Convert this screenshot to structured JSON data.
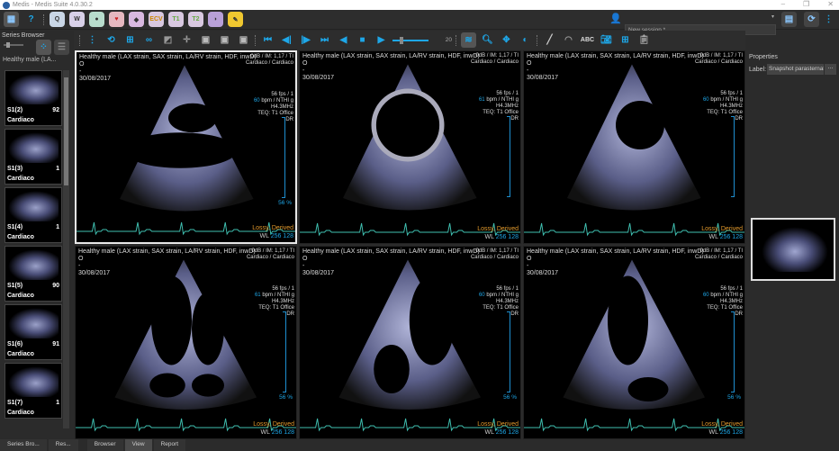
{
  "window": {
    "app": "Medis",
    "title": "Medis Suite 4.0.30.2"
  },
  "toolbar": {
    "help": "?",
    "apps": [
      "QMass",
      "QFlow",
      "3DView",
      "QStrain",
      "QTavi",
      "ECV",
      "T1",
      "T2",
      "QAngio",
      "Report"
    ],
    "session": "New session *",
    "frame_value": "20"
  },
  "left_panel": {
    "title": "Series Browser",
    "series_name": "Healthy male (LA...",
    "thumbnails": [
      {
        "label": "S1(2)",
        "count": "92",
        "sub": "Cardiaco"
      },
      {
        "label": "S1(3)",
        "count": "1",
        "sub": "Cardiaco"
      },
      {
        "label": "S1(4)",
        "count": "1",
        "sub": "Cardiaco"
      },
      {
        "label": "S1(5)",
        "count": "90",
        "sub": "Cardiaco"
      },
      {
        "label": "S1(6)",
        "count": "91",
        "sub": "Cardiaco"
      },
      {
        "label": "S1(7)",
        "count": "1",
        "sub": "Cardiaco"
      }
    ]
  },
  "viewports": [
    {
      "patient": "Healthy male (LAX strain, SAX strain, LA/RV strain, HDF, inwD)",
      "line2": "O",
      "line3": "-",
      "date": "30/08/2017",
      "tr1": "0dB / IM: 1,17 / TI",
      "tr2": "Cardiaco / Cardiaco",
      "fps": "56 fps / 1",
      "bpm": "60",
      "bpm_suffix": " bpm / NTHI g",
      "probe": "H4.3MHz",
      "teq": "TEQ: T1 Office",
      "dr": "DR",
      "pct": "56 %",
      "lossy": "Lossy, Derived",
      "wl_label": "WL ",
      "wl": "256 128"
    },
    {
      "patient": "Healthy male (LAX strain, SAX strain, LA/RV strain, HDF, inwD)",
      "line2": "O",
      "line3": "-",
      "date": "30/08/2017",
      "tr1": "0dB / IM: 1,17 / TI",
      "tr2": "Cardiaco / Cardiaco",
      "fps": "56 fps / 1",
      "bpm": "61",
      "bpm_suffix": " bpm / NTHI g",
      "probe": "H4.3MHz",
      "teq": "TEQ: T1 Office",
      "dr": "DR",
      "pct": "",
      "lossy": "Lossy, Derived",
      "wl_label": "WL ",
      "wl": "256 128"
    },
    {
      "patient": "Healthy male (LAX strain, SAX strain, LA/RV strain, HDF, inwD)",
      "line2": "O",
      "line3": "-",
      "date": "30/08/2017",
      "tr1": "0dB / IM: 1,17 / TI",
      "tr2": "Cardiaco / Cardiaco",
      "fps": "56 fps / 1",
      "bpm": "60",
      "bpm_suffix": " bpm / NTHI g",
      "probe": "H4.3MHz",
      "teq": "TEQ: T1 Office",
      "dr": "DR",
      "pct": "",
      "lossy": "Lossy, Derived",
      "wl_label": "WL ",
      "wl": "256 128"
    },
    {
      "patient": "Healthy male (LAX strain, SAX strain, LA/RV strain, HDF, inwD)",
      "line2": "O",
      "line3": "-",
      "date": "30/08/2017",
      "tr1": "0dB / IM: 1,17 / TI",
      "tr2": "Cardiaco / Cardiaco",
      "fps": "56 fps / 1",
      "bpm": "61",
      "bpm_suffix": " bpm / NTHI g",
      "probe": "H4.3MHz",
      "teq": "TEQ: T1 Office",
      "dr": "DR",
      "pct": "56 %",
      "lossy": "Lossy, Derived",
      "wl_label": "WL ",
      "wl": "256 128"
    },
    {
      "patient": "Healthy male (LAX strain, SAX strain, LA/RV strain, HDF, inwD)",
      "line2": "O",
      "line3": "-",
      "date": "30/08/2017",
      "tr1": "0dB / IM: 1,17 / TI",
      "tr2": "Cardiaco / Cardiaco",
      "fps": "56 fps / 1",
      "bpm": "60",
      "bpm_suffix": " bpm / NTHI g",
      "probe": "H4.3MHz",
      "teq": "TEQ: T1 Office",
      "dr": "DR",
      "pct": "56 %",
      "lossy": "Lossy, Derived",
      "wl_label": "WL ",
      "wl": "256 128"
    },
    {
      "patient": "Healthy male (LAX strain, SAX strain, LA/RV strain, HDF, inwD)",
      "line2": "O",
      "line3": "-",
      "date": "30/08/2017",
      "tr1": "0dB / IM: 1,17 / TI",
      "tr2": "Cardiaco / Cardiaco",
      "fps": "56 fps / 1",
      "bpm": "60",
      "bpm_suffix": " bpm / NTHI g",
      "probe": "H4.3MHz",
      "teq": "TEQ: T1 Office",
      "dr": "DR",
      "pct": "56 %",
      "lossy": "Lossy, Derived",
      "wl_label": "WL ",
      "wl": "256 128"
    }
  ],
  "properties": {
    "title": "Properties",
    "label_caption": "Label:",
    "label_value": "Snapshot parasternal",
    "more": "..."
  },
  "bottom_tabs": [
    "Series Bro...",
    "Res...",
    "Browser",
    "View",
    "Report"
  ],
  "colors": {
    "accent": "#1ea7e8",
    "lossy": "#e39a2c"
  }
}
